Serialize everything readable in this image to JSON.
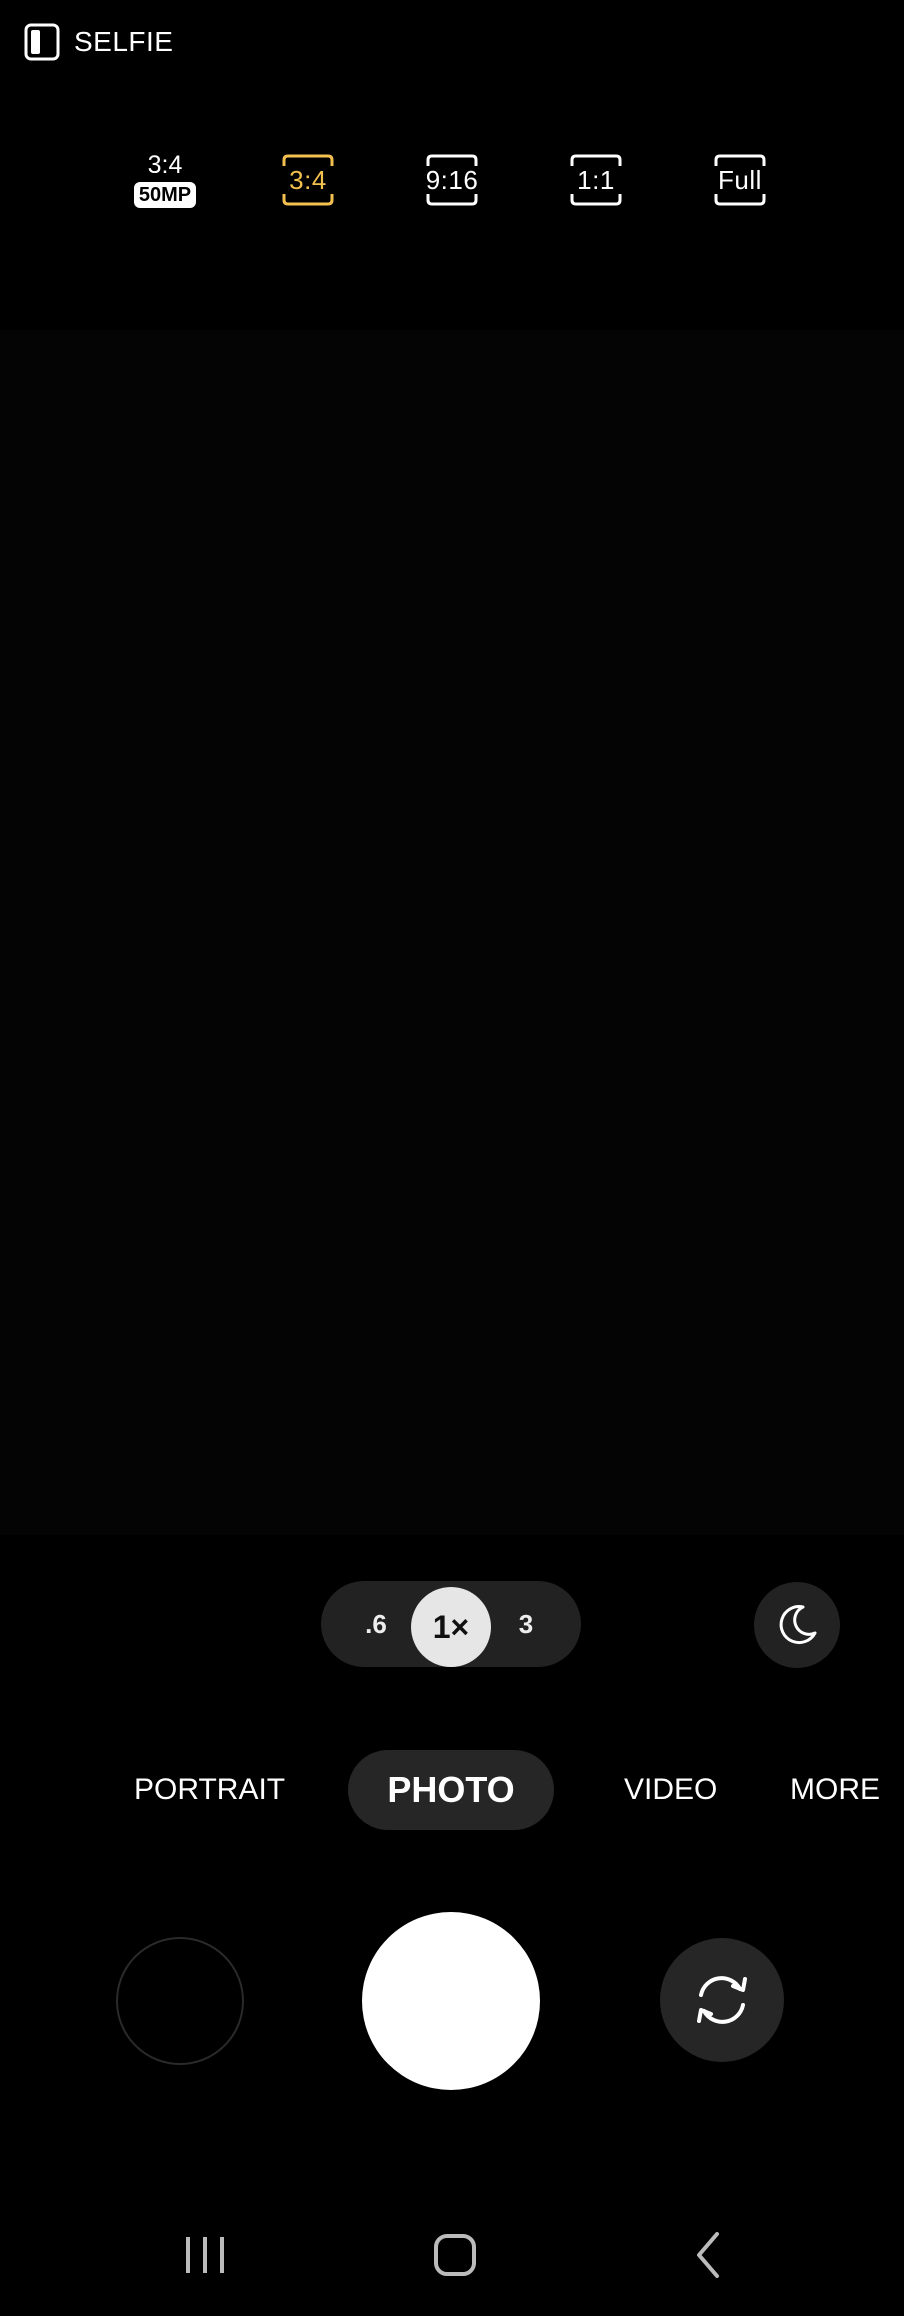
{
  "top": {
    "mode_label": "SELFIE"
  },
  "ratios": {
    "r50": {
      "top": "3:4",
      "badge": "50MP"
    },
    "r34": "3:4",
    "r916": "9:16",
    "r11": "1:1",
    "full": "Full"
  },
  "zoom": {
    "wide": ".6",
    "main": "1×",
    "tele": "3"
  },
  "modes": {
    "portrait": "PORTRAIT",
    "photo": "PHOTO",
    "video": "VIDEO",
    "more": "MORE"
  },
  "colors": {
    "accent_selected": "#f2c14e",
    "background": "#000000"
  },
  "icons": [
    "selfie-icon",
    "moon-icon",
    "switch-camera-icon",
    "recent-apps-icon",
    "home-icon",
    "back-icon"
  ]
}
